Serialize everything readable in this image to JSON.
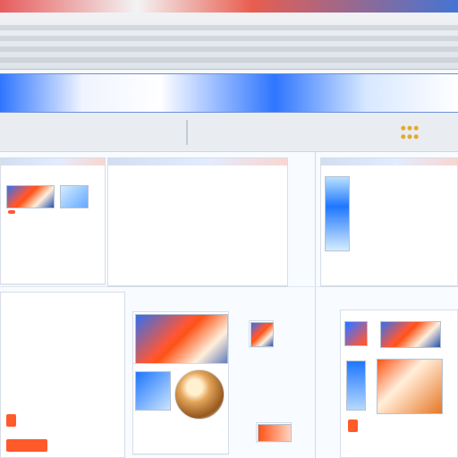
{
  "app": {
    "title": ""
  },
  "nav": {
    "items": [
      {
        "label": ""
      },
      {
        "label": ""
      },
      {
        "label": ""
      },
      {
        "label": ""
      },
      {
        "label": ""
      }
    ]
  },
  "panels": {
    "left_top": {
      "chip": "",
      "lines": [
        "",
        "",
        "",
        "",
        ""
      ]
    },
    "center_top": {
      "lines": [
        "",
        "",
        "",
        "",
        "",
        "",
        "",
        "",
        ""
      ]
    },
    "right_top": {
      "lines": [
        "",
        "",
        "",
        "",
        "",
        "",
        ""
      ]
    },
    "bottom_left": {
      "lines": [
        "",
        "",
        "",
        "",
        "",
        ""
      ]
    }
  },
  "colors": {
    "accent_red": "#ff5a2a",
    "accent_blue": "#2e75ff",
    "panel_border": "#d6dee8"
  },
  "icons": {
    "toolbar_icon": "grid-icon"
  }
}
